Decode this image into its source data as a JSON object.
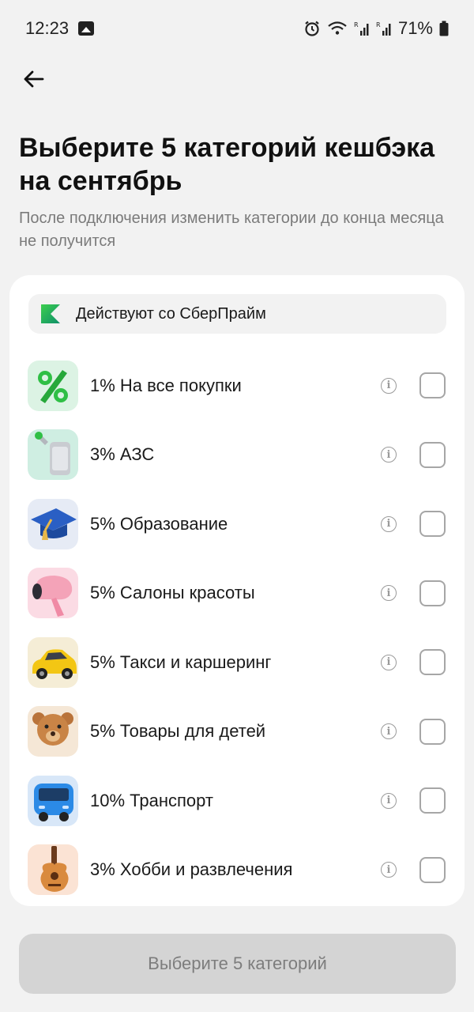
{
  "status_bar": {
    "time": "12:23",
    "battery": "71%"
  },
  "header": {
    "title": "Выберите 5 категорий кешбэка на сентябрь",
    "subtitle": "После подключения изменить категории до конца месяца не получится"
  },
  "banner": {
    "label": "Действуют со СберПрайм"
  },
  "categories": [
    {
      "label": "1% На все покупки",
      "icon": "percent-icon",
      "checked": false
    },
    {
      "label": "3% АЗС",
      "icon": "fuel-canister-icon",
      "checked": false
    },
    {
      "label": "5% Образование",
      "icon": "graduation-cap-icon",
      "checked": false
    },
    {
      "label": "5% Салоны красоты",
      "icon": "hair-dryer-icon",
      "checked": false
    },
    {
      "label": "5% Такси и каршеринг",
      "icon": "taxi-car-icon",
      "checked": false
    },
    {
      "label": "5% Товары для детей",
      "icon": "teddy-bear-icon",
      "checked": false
    },
    {
      "label": "10% Транспорт",
      "icon": "bus-icon",
      "checked": false
    },
    {
      "label": "3% Хобби и развлечения",
      "icon": "guitar-icon",
      "checked": false
    }
  ],
  "cta": {
    "label": "Выберите 5 категорий"
  },
  "colors": {
    "background": "#f2f2f2",
    "card": "#ffffff",
    "cta_disabled": "#d4d4d4",
    "sberprime_green": "#21a038"
  }
}
